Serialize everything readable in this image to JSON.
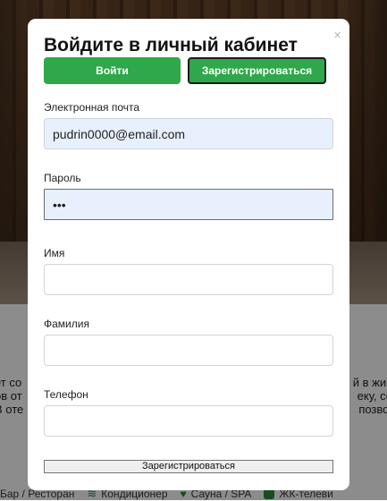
{
  "background": {
    "text_lines": [
      {
        "left": "ет со",
        "right": "й в жив"
      },
      {
        "left": "ов от",
        "right": "еку, со"
      },
      {
        "left": "В оте",
        "right": "позво."
      }
    ],
    "amenities": [
      {
        "label": "Бар / Ресторан",
        "icon": "bar-icon"
      },
      {
        "label": "Кондиционер",
        "icon": "air-conditioner-icon"
      },
      {
        "label": "Сауна / SPA",
        "icon": "spa-icon"
      },
      {
        "label": "ЖК-телеви",
        "icon": "tv-icon"
      }
    ]
  },
  "modal": {
    "title": "Войдите в личный кабинет",
    "close_symbol": "×",
    "tabs": {
      "login": "Войти",
      "register": "Зарегистрироваться"
    },
    "fields": {
      "email": {
        "label": "Электронная почта",
        "value": "pudrin0000@email.com",
        "placeholder": ""
      },
      "password": {
        "label": "Пароль",
        "value": "qwe",
        "placeholder": ""
      },
      "first_name": {
        "label": "Имя",
        "value": "",
        "placeholder": ""
      },
      "last_name": {
        "label": "Фамилия",
        "value": "",
        "placeholder": ""
      },
      "phone": {
        "label": "Телефон",
        "value": "",
        "placeholder": ""
      }
    },
    "submit_label": "Зарегистрироваться"
  },
  "colors": {
    "accent_green": "#2ea84a",
    "autofill_blue": "#e8f0fe",
    "overlay": "rgba(0,0,0,0.45)"
  }
}
